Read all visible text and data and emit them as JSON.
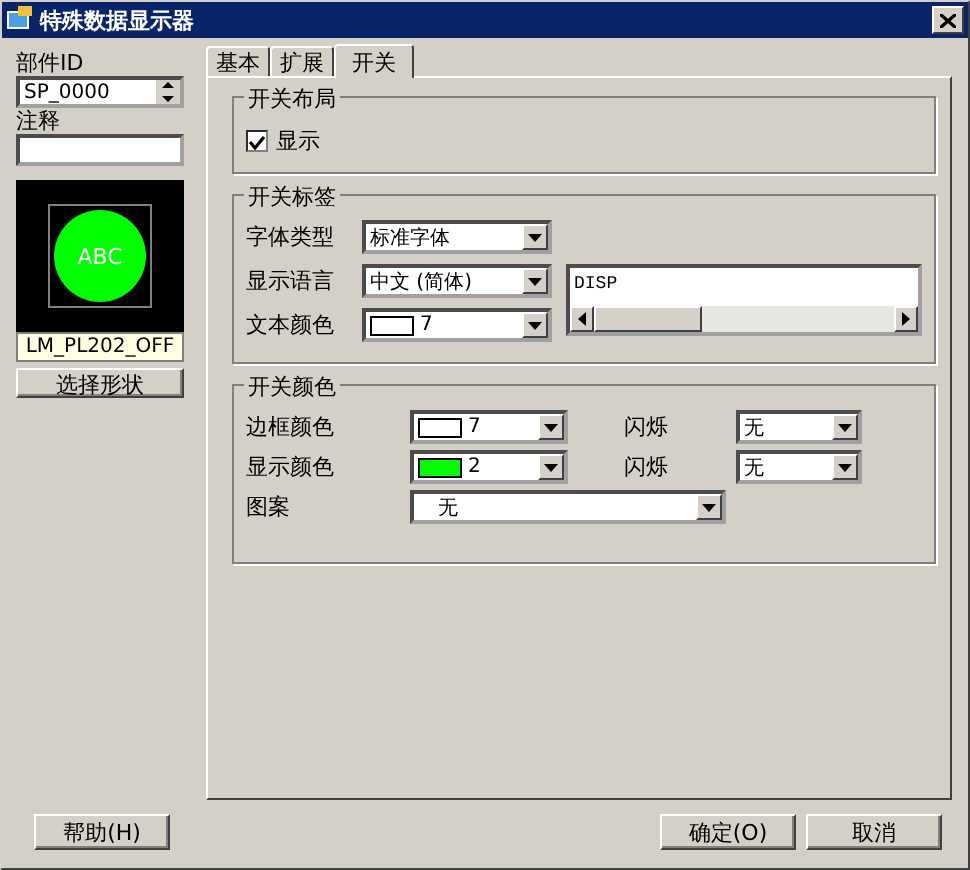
{
  "window": {
    "title": "特殊数据显示器"
  },
  "left": {
    "part_id_label": "部件ID",
    "part_id": "SP_0000",
    "comment_label": "注释",
    "preview": {
      "text": "ABC",
      "color": "#00ff00",
      "caption": "LM_PL202_OFF"
    },
    "shape_button": "选择形状"
  },
  "tabs": [
    {
      "label": "基本",
      "selected": false
    },
    {
      "label": "扩展",
      "selected": false
    },
    {
      "label": "开关",
      "selected": true
    }
  ],
  "layout_group": {
    "title": "开关布局",
    "checkbox": {
      "label": "显示",
      "checked": true
    }
  },
  "label_group": {
    "title": "开关标签",
    "rows": [
      {
        "label": "字体类型",
        "value": "标准字体"
      },
      {
        "label": "显示语言",
        "value": "中文 (简体)"
      },
      {
        "label": "文本颜色",
        "value": "7",
        "color": "#ffffff"
      }
    ],
    "text": "DISP"
  },
  "color_group": {
    "title": "开关颜色",
    "rows": [
      {
        "label": "边框颜色",
        "value": "7",
        "color": "#ffffff",
        "blink_label": "闪烁",
        "blink": "无"
      },
      {
        "label": "显示颜色",
        "value": "2",
        "color": "#00ff00",
        "blink_label": "闪烁",
        "blink": "无"
      }
    ],
    "pattern": {
      "label": "图案",
      "value": "无"
    }
  },
  "buttons": {
    "help": "帮助(H)",
    "ok": "确定(O)",
    "cancel": "取消"
  }
}
